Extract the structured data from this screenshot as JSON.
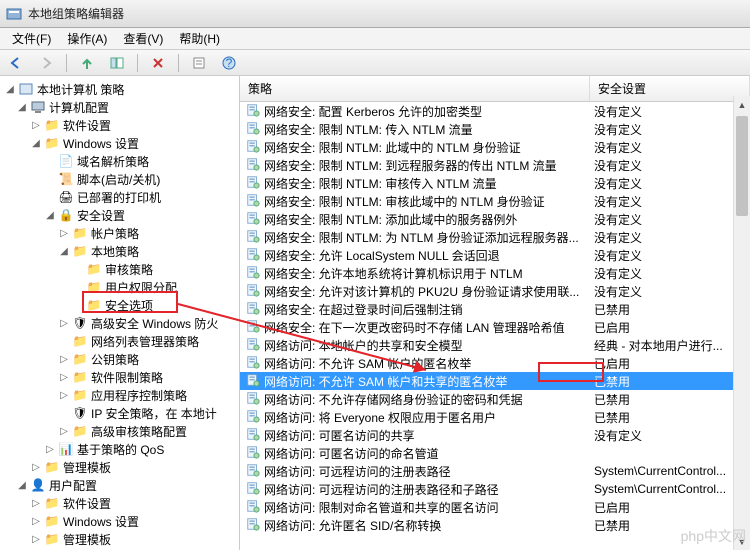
{
  "window": {
    "title": "本地组策略编辑器"
  },
  "menu": {
    "file": "文件(F)",
    "action": "操作(A)",
    "view": "查看(V)",
    "help": "帮助(H)"
  },
  "tree": {
    "root": "本地计算机 策略",
    "computer_cfg": "计算机配置",
    "software_settings": "软件设置",
    "windows_settings": "Windows 设置",
    "name_res": "域名解析策略",
    "scripts": "脚本(启动/关机)",
    "deployed_printers": "已部署的打印机",
    "security_settings": "安全设置",
    "account_policies": "帐户策略",
    "local_policies": "本地策略",
    "audit_policy": "审核策略",
    "user_rights": "用户权限分配",
    "security_options": "安全选项",
    "firewall": "高级安全 Windows 防火",
    "nlm": "网络列表管理器策略",
    "public_key": "公钥策略",
    "software_restrict": "软件限制策略",
    "app_control": "应用程序控制策略",
    "ipsec": "IP 安全策略，在 本地计",
    "adv_audit": "高级审核策略配置",
    "qos": "基于策略的 QoS",
    "admin_templates": "管理模板",
    "user_cfg": "用户配置",
    "u_software": "软件设置",
    "u_windows": "Windows 设置",
    "u_admin": "管理模板"
  },
  "list": {
    "col_policy": "策略",
    "col_setting": "安全设置",
    "rows": [
      {
        "p": "网络安全: 配置 Kerberos 允许的加密类型",
        "s": "没有定义"
      },
      {
        "p": "网络安全: 限制 NTLM: 传入 NTLM 流量",
        "s": "没有定义"
      },
      {
        "p": "网络安全: 限制 NTLM: 此域中的 NTLM 身份验证",
        "s": "没有定义"
      },
      {
        "p": "网络安全: 限制 NTLM: 到远程服务器的传出 NTLM 流量",
        "s": "没有定义"
      },
      {
        "p": "网络安全: 限制 NTLM: 审核传入 NTLM 流量",
        "s": "没有定义"
      },
      {
        "p": "网络安全: 限制 NTLM: 审核此域中的 NTLM 身份验证",
        "s": "没有定义"
      },
      {
        "p": "网络安全: 限制 NTLM: 添加此域中的服务器例外",
        "s": "没有定义"
      },
      {
        "p": "网络安全: 限制 NTLM: 为 NTLM 身份验证添加远程服务器...",
        "s": "没有定义"
      },
      {
        "p": "网络安全: 允许 LocalSystem NULL 会话回退",
        "s": "没有定义"
      },
      {
        "p": "网络安全: 允许本地系统将计算机标识用于 NTLM",
        "s": "没有定义"
      },
      {
        "p": "网络安全: 允许对该计算机的 PKU2U 身份验证请求使用联...",
        "s": "没有定义"
      },
      {
        "p": "网络安全: 在超过登录时间后强制注销",
        "s": "已禁用"
      },
      {
        "p": "网络安全: 在下一次更改密码时不存储 LAN 管理器哈希值",
        "s": "已启用"
      },
      {
        "p": "网络访问: 本地帐户的共享和安全模型",
        "s": "经典 - 对本地用户进行..."
      },
      {
        "p": "网络访问: 不允许 SAM 帐户的匿名枚举",
        "s": "已启用"
      },
      {
        "p": "网络访问: 不允许 SAM 帐户和共享的匿名枚举",
        "s": "已禁用",
        "sel": true
      },
      {
        "p": "网络访问: 不允许存储网络身份验证的密码和凭据",
        "s": "已禁用"
      },
      {
        "p": "网络访问: 将 Everyone 权限应用于匿名用户",
        "s": "已禁用"
      },
      {
        "p": "网络访问: 可匿名访问的共享",
        "s": "没有定义"
      },
      {
        "p": "网络访问: 可匿名访问的命名管道",
        "s": ""
      },
      {
        "p": "网络访问: 可远程访问的注册表路径",
        "s": "System\\CurrentControl..."
      },
      {
        "p": "网络访问: 可远程访问的注册表路径和子路径",
        "s": "System\\CurrentControl..."
      },
      {
        "p": "网络访问: 限制对命名管道和共享的匿名访问",
        "s": "已启用"
      },
      {
        "p": "网络访问: 允许匿名 SID/名称转换",
        "s": "已禁用"
      }
    ]
  },
  "watermark": "php中文网"
}
